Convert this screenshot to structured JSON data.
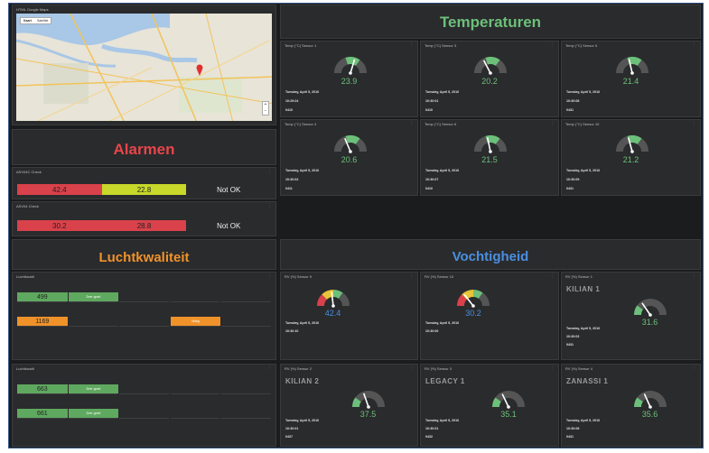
{
  "map": {
    "title": "HTML Google Maps",
    "btn_map": "Kaart",
    "btn_sat": "Satelliet"
  },
  "alarmen": {
    "title": "Alarmen",
    "color": "#e8454a"
  },
  "alarm_panels": [
    {
      "title": "ASV04C Check",
      "v1": "42.4",
      "v2": "22.8",
      "status": "Not OK",
      "c1": "#d9414b",
      "c2": "#c8d82a"
    },
    {
      "title": "ASV04 Check",
      "v1": "30.2",
      "v2": "28.8",
      "status": "Not OK",
      "c1": "#d9414b",
      "c2": "#d9414b"
    }
  ],
  "luchtkwaliteit": {
    "title": "Luchtkwaliteit",
    "color": "#f0922a"
  },
  "lk_panels": [
    {
      "title": "Luchtkwalit",
      "rows": [
        {
          "value": "499",
          "tag": "Zeer goed",
          "color": "#5fa85f",
          "tagcolor": "#5fa85f",
          "tagpos": 1
        },
        {
          "value": "1169",
          "tag": "Matig",
          "color": "#f0922a",
          "tagcolor": "#f0922a",
          "tagpos": 3
        }
      ]
    },
    {
      "title": "Luchtkwalit",
      "rows": [
        {
          "value": "663",
          "tag": "Zeer goed",
          "color": "#5fa85f",
          "tagcolor": "#5fa85f",
          "tagpos": 1
        },
        {
          "value": "661",
          "tag": "Zeer goed",
          "color": "#5fa85f",
          "tagcolor": "#5fa85f",
          "tagpos": 1
        }
      ]
    }
  ],
  "temperaturen": {
    "title": "Temperaturen",
    "color": "#6cc07a"
  },
  "temp_gauges": [
    {
      "title": "Temp (°C) Sensor 1",
      "value": "23.9",
      "date": "Tuesday, April 5, 2016",
      "time": "10:29:24",
      "extra": "0410"
    },
    {
      "title": "Temp (°C) Sensor 3",
      "value": "20.2",
      "date": "Tuesday, April 5, 2016",
      "time": "10:30:01",
      "extra": "0410"
    },
    {
      "title": "Temp (°C) Sensor 5",
      "value": "21.4",
      "date": "Tuesday, April 5, 2016",
      "time": "10:30:08",
      "extra": "0431"
    },
    {
      "title": "Temp (°C) Sensor 4",
      "value": "20.6",
      "date": "Tuesday, April 5, 2016",
      "time": "10:30:02",
      "extra": "0411"
    },
    {
      "title": "Temp (°C) Sensor 6",
      "value": "21.5",
      "date": "Tuesday, April 5, 2016",
      "time": "10:30:07",
      "extra": "0410"
    },
    {
      "title": "Temp (°C) Sensor 10",
      "value": "21.2",
      "date": "Tuesday, April 5, 2016",
      "time": "10:30:09",
      "extra": "0431"
    }
  ],
  "vochtigheid": {
    "title": "Vochtigheid",
    "color": "#4a8fe0"
  },
  "rh_gauges": [
    {
      "title": "RV (%) Sensor 9",
      "name": "",
      "value": "42.4",
      "date": "Tuesday, April 5, 2016",
      "time": "10:30:10",
      "extra": "",
      "color": "#4a8fe0",
      "kind": "color"
    },
    {
      "title": "RV (%) Sensor 10",
      "name": "",
      "value": "30.2",
      "date": "Tuesday, April 5, 2016",
      "time": "10:30:06",
      "extra": "",
      "color": "#4a8fe0",
      "kind": "color"
    },
    {
      "title": "RV (%) Sensor 1",
      "name": "KILIAN 1",
      "value": "31.6",
      "date": "Tuesday, April 5, 2016",
      "time": "10:30:03",
      "extra": "0431",
      "color": "#6cc07a",
      "kind": "grey"
    },
    {
      "title": "RV (%) Sensor 2",
      "name": "KILIAN 2",
      "value": "37.5",
      "date": "Tuesday, April 5, 2016",
      "time": "10:30:01",
      "extra": "0437",
      "color": "#6cc07a",
      "kind": "grey"
    },
    {
      "title": "RV (%) Sensor 3",
      "name": "LEGACY 1",
      "value": "35.1",
      "date": "Tuesday, April 5, 2016",
      "time": "10:30:01",
      "extra": "0432",
      "color": "#6cc07a",
      "kind": "grey"
    },
    {
      "title": "RV (%) Sensor 4",
      "name": "ZANASSI 1",
      "value": "35.6",
      "date": "Tuesday, April 5, 2016",
      "time": "10:30:08",
      "extra": "0431",
      "color": "#6cc07a",
      "kind": "grey"
    }
  ]
}
